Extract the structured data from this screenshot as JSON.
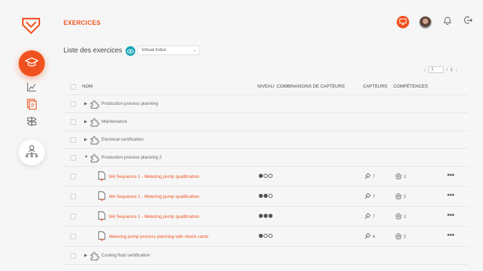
{
  "colors": {
    "accent": "#f0521f",
    "teal": "#1aa5b8",
    "background": "#f6f6f6"
  },
  "sidebar": {
    "logo": "fox-logo-icon",
    "items": [
      {
        "icon": "graduation-cap-icon",
        "active": true
      },
      {
        "icon": "chart-line-icon",
        "active": false
      },
      {
        "icon": "exercise-doc-icon",
        "active": true
      },
      {
        "icon": "signpost-icon",
        "active": false
      },
      {
        "icon": "user-hierarchy-icon",
        "active": false
      }
    ]
  },
  "header": {
    "title": "EXERCICES",
    "icons": [
      "screen-icon",
      "avatar",
      "bell-icon",
      "logout-icon"
    ]
  },
  "subheader": {
    "list_title": "Liste des exercices",
    "select_value": "Virtual Indus"
  },
  "pagination": {
    "current": "1",
    "separator": "/",
    "total": "1"
  },
  "table": {
    "headers": {
      "name": "NOM",
      "level": "NIVEAU",
      "combinations": "COMBINAISONS DE CAPTEURS",
      "sensors": "CAPTEURS",
      "skills": "COMPÉTENCES"
    },
    "rows": [
      {
        "type": "folder",
        "label": "Production process planning",
        "expanded": false
      },
      {
        "type": "folder",
        "label": "Maintenance",
        "expanded": false
      },
      {
        "type": "folder",
        "label": "Electrical certification",
        "expanded": false
      },
      {
        "type": "folder",
        "label": "Production process planning 2",
        "expanded": true
      },
      {
        "type": "exercise",
        "label": "M4 Sequence 1 - Metering pump qualification",
        "level": 1,
        "sensors": "7",
        "skills": "2"
      },
      {
        "type": "exercise",
        "label": "M4 Sequence 1 - Metering pump qualification",
        "level": 2,
        "sensors": "7",
        "skills": "2"
      },
      {
        "type": "exercise",
        "label": "M4 Sequence 1 - Metering pump qualification",
        "level": 3,
        "sensors": "7",
        "skills": "2"
      },
      {
        "type": "exercise",
        "label": "Metering pump process planning with check cards",
        "level": 1,
        "sensors": "6",
        "skills": "2"
      },
      {
        "type": "folder",
        "label": "Cooling fluid certification",
        "expanded": false
      }
    ]
  }
}
